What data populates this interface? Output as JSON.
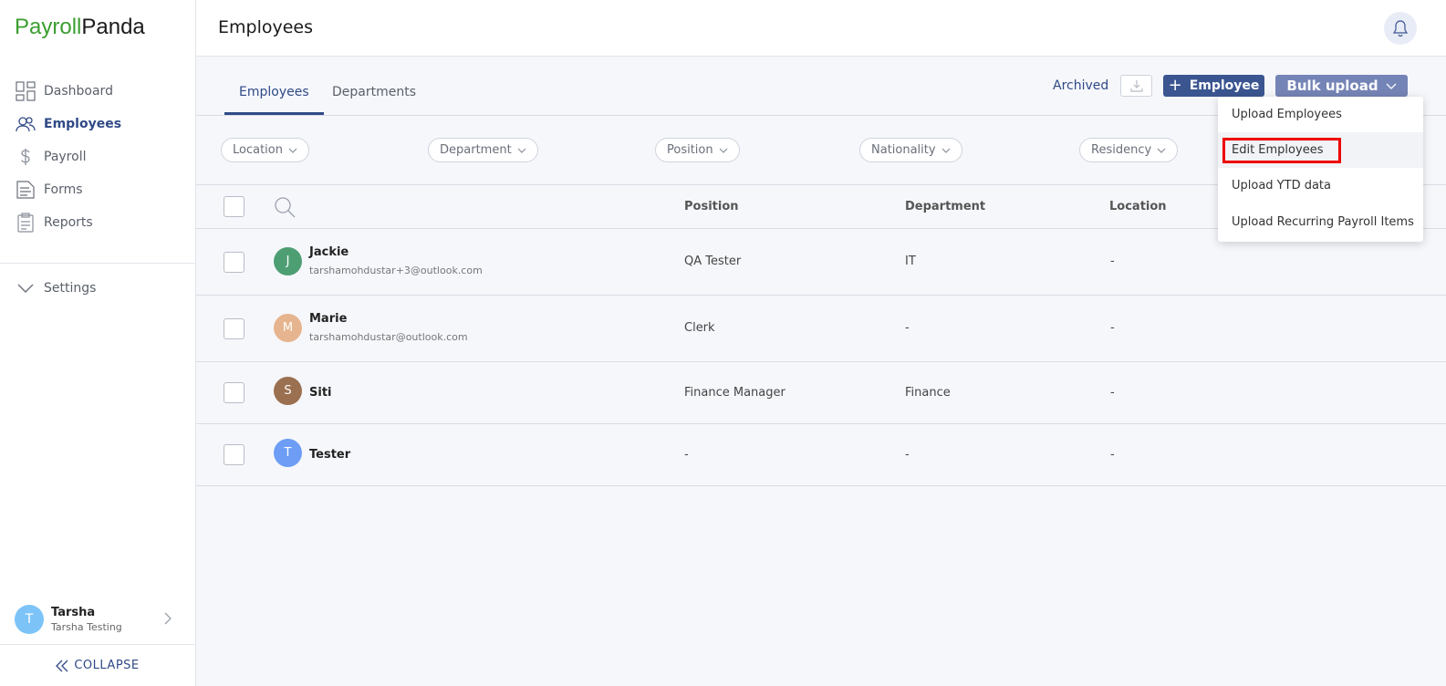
{
  "brand": {
    "part1": "Payroll",
    "part2": "Panda"
  },
  "sidebar": {
    "items": [
      {
        "label": "Dashboard",
        "icon": "dashboard-icon"
      },
      {
        "label": "Employees",
        "icon": "users-icon"
      },
      {
        "label": "Payroll",
        "icon": "dollar-icon"
      },
      {
        "label": "Forms",
        "icon": "forms-icon"
      },
      {
        "label": "Reports",
        "icon": "clipboard-icon"
      }
    ],
    "settings_label": "Settings",
    "user": {
      "initial": "T",
      "name": "Tarsha",
      "subtitle": "Tarsha Testing"
    },
    "collapse_label": "COLLAPSE"
  },
  "header": {
    "title": "Employees"
  },
  "tabs": [
    {
      "label": "Employees"
    },
    {
      "label": "Departments"
    }
  ],
  "actions": {
    "archived_label": "Archived",
    "add_employee_label": "Employee",
    "bulk_upload_label": "Bulk upload"
  },
  "filters": [
    {
      "label": "Location"
    },
    {
      "label": "Department"
    },
    {
      "label": "Position"
    },
    {
      "label": "Nationality"
    },
    {
      "label": "Residency"
    }
  ],
  "table": {
    "columns": [
      "Position",
      "Department",
      "Location"
    ],
    "rows": [
      {
        "initial": "J",
        "name": "Jackie",
        "email": "tarshamohdustar+3@outlook.com",
        "position": "QA Tester",
        "department": "IT",
        "location": "-",
        "color": "#4e9e73"
      },
      {
        "initial": "M",
        "name": "Marie",
        "email": "tarshamohdustar@outlook.com",
        "position": "Clerk",
        "department": "-",
        "location": "-",
        "color": "#e6b48e"
      },
      {
        "initial": "S",
        "name": "Siti",
        "email": "",
        "position": "Finance Manager",
        "department": "Finance",
        "location": "-",
        "color": "#9a7050"
      },
      {
        "initial": "T",
        "name": "Tester",
        "email": "",
        "position": "-",
        "department": "-",
        "location": "-",
        "color": "#6d9df5"
      }
    ]
  },
  "bulk_menu": {
    "items": [
      {
        "label": "Upload Employees"
      },
      {
        "label": "Edit Employees"
      },
      {
        "label": "Upload YTD data"
      },
      {
        "label": "Upload Recurring Payroll Items"
      }
    ]
  },
  "colors": {
    "accent": "#2f4a86",
    "primary_button": "#3b5591",
    "bulk_button": "#7584b6",
    "highlight": "#e00000"
  }
}
